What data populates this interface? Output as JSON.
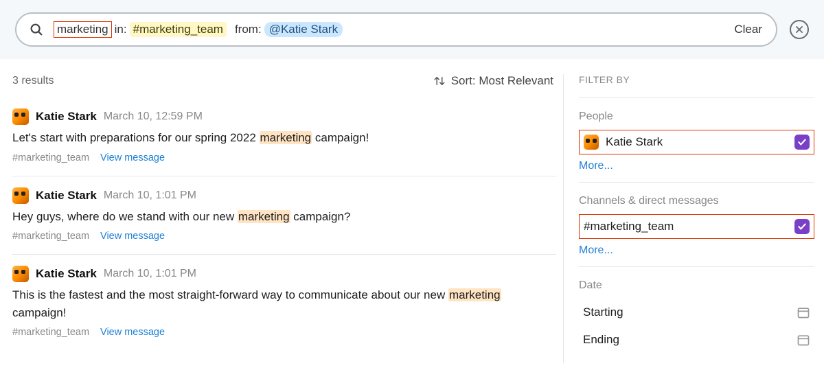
{
  "search": {
    "keyword": "marketing",
    "in_prefix": "in:",
    "in_value": "#marketing_team",
    "from_prefix": "from:",
    "from_value": "@Katie Stark",
    "clear_label": "Clear"
  },
  "results": {
    "count_label": "3 results",
    "sort_label": "Sort: Most Relevant",
    "items": [
      {
        "author": "Katie Stark",
        "time": "March 10, 12:59 PM",
        "body_pre": "Let's start with preparations for our spring 2022 ",
        "body_hl": "marketing",
        "body_post": " campaign!",
        "channel": "#marketing_team",
        "view_label": "View message"
      },
      {
        "author": "Katie Stark",
        "time": "March 10, 1:01 PM",
        "body_pre": "Hey guys, where do we stand with our new ",
        "body_hl": "marketing",
        "body_post": " campaign?",
        "channel": "#marketing_team",
        "view_label": "View message"
      },
      {
        "author": "Katie Stark",
        "time": "March 10, 1:01 PM",
        "body_pre": "This is the fastest and the most straight-forward way to communicate about our new ",
        "body_hl": "marketing",
        "body_post": " campaign!",
        "channel": "#marketing_team",
        "view_label": "View message"
      }
    ]
  },
  "filters": {
    "title": "FILTER BY",
    "people": {
      "label": "People",
      "selected": "Katie Stark",
      "more_label": "More..."
    },
    "channels": {
      "label": "Channels & direct messages",
      "selected": "#marketing_team",
      "more_label": "More..."
    },
    "date": {
      "label": "Date",
      "starting_label": "Starting",
      "ending_label": "Ending"
    }
  },
  "colors": {
    "accent_checkbox": "#7a3fc7",
    "link": "#1e7fd6",
    "highlight_red": "#d93400"
  }
}
